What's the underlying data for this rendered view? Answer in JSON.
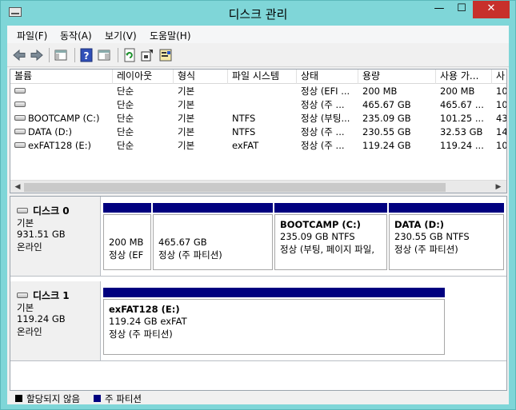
{
  "window": {
    "title": "디스크 관리",
    "minimize": "—",
    "maximize": "☐",
    "close": "✕"
  },
  "menu": [
    "파일(F)",
    "동작(A)",
    "보기(V)",
    "도움말(H)"
  ],
  "volume_table": {
    "columns": [
      "볼륨",
      "레이아웃",
      "형식",
      "파일 시스템",
      "상태",
      "용량",
      "사용 가...",
      "사"
    ],
    "rows": [
      [
        "",
        "단순",
        "기본",
        "",
        "정상 (EFI ...",
        "200 MB",
        "200 MB",
        "10("
      ],
      [
        "",
        "단순",
        "기본",
        "",
        "정상 (주 ...",
        "465.67 GB",
        "465.67 ...",
        "10("
      ],
      [
        "BOOTCAMP (C:)",
        "단순",
        "기본",
        "NTFS",
        "정상 (부팅...",
        "235.09 GB",
        "101.25 ...",
        "43"
      ],
      [
        "DATA (D:)",
        "단순",
        "기본",
        "NTFS",
        "정상 (주 ...",
        "230.55 GB",
        "32.53 GB",
        "14"
      ],
      [
        "exFAT128 (E:)",
        "단순",
        "기본",
        "exFAT",
        "정상 (주 ...",
        "119.24 GB",
        "119.24 ...",
        "10("
      ]
    ]
  },
  "disks": [
    {
      "name": "디스크 0",
      "type": "기본",
      "size": "931.51 GB",
      "status": "온라인",
      "partitions": [
        {
          "name": "",
          "size": "200 MB",
          "status": "정상 (EF"
        },
        {
          "name": "",
          "size": "465.67 GB",
          "status": "정상 (주 파티션)"
        },
        {
          "name": "BOOTCAMP  (C:)",
          "size": "235.09 GB NTFS",
          "status": "정상 (부팅, 페이지 파일,"
        },
        {
          "name": "DATA  (D:)",
          "size": "230.55 GB NTFS",
          "status": "정상 (주 파티션)"
        }
      ]
    },
    {
      "name": "디스크 1",
      "type": "기본",
      "size": "119.24 GB",
      "status": "온라인",
      "partitions": [
        {
          "name": "exFAT128  (E:)",
          "size": "119.24 GB exFAT",
          "status": "정상 (주 파티션)"
        }
      ]
    }
  ],
  "legend": [
    {
      "label": "할당되지 않음",
      "color": "#000000"
    },
    {
      "label": "주 파티션",
      "color": "#00007f"
    }
  ]
}
